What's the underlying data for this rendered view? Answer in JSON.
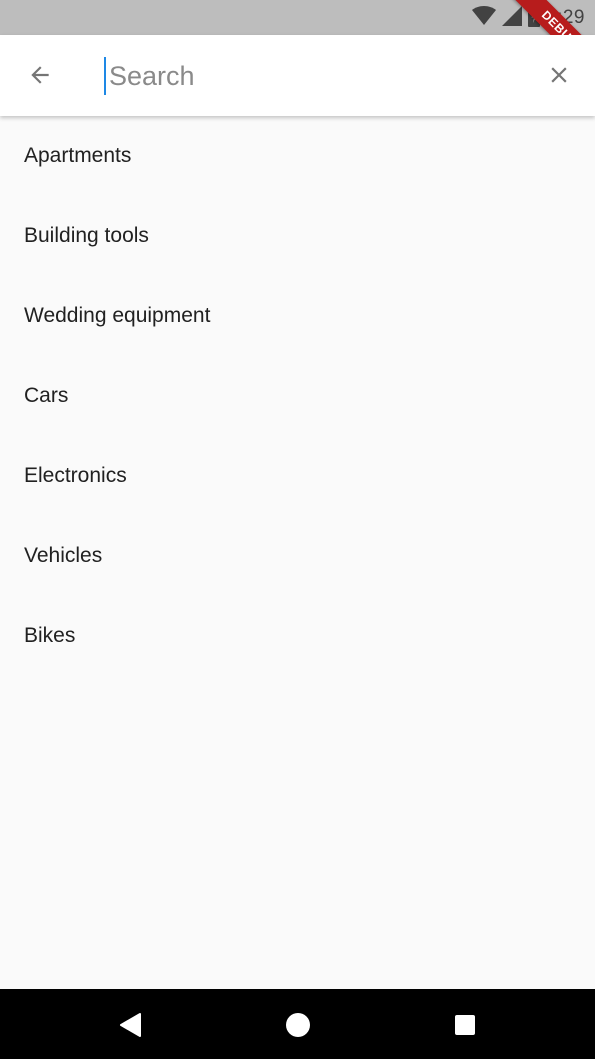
{
  "status_bar": {
    "time": "2:29",
    "icons": [
      "wifi-icon",
      "signal-icon",
      "battery-icon"
    ]
  },
  "debug_banner": {
    "label": "DEBUG"
  },
  "app_bar": {
    "back_icon": "arrow-back-icon",
    "search": {
      "value": "",
      "placeholder": "Search"
    },
    "clear_icon": "close-icon"
  },
  "results": [
    {
      "label": "Apartments"
    },
    {
      "label": "Building tools"
    },
    {
      "label": "Wedding equipment"
    },
    {
      "label": "Cars"
    },
    {
      "label": "Electronics"
    },
    {
      "label": "Vehicles"
    },
    {
      "label": "Bikes"
    }
  ],
  "nav_bar": {
    "icons": [
      "back-triangle-icon",
      "home-circle-icon",
      "recents-square-icon"
    ]
  },
  "colors": {
    "status_bar_bg": "#bdbdbd",
    "app_bar_bg": "#ffffff",
    "page_bg": "#fafafa",
    "cursor": "#1e88e5",
    "debug_ribbon": "#b71c1c",
    "nav_bar_bg": "#000000"
  }
}
